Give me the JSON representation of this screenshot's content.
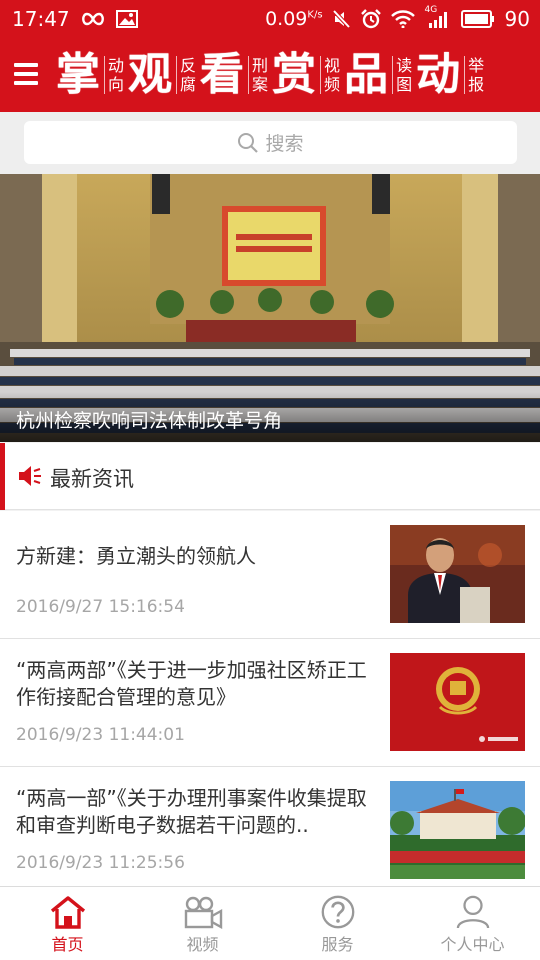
{
  "status_bar": {
    "time": "17:47",
    "network_speed": "0.09",
    "network_speed_unit": "K/s",
    "network_type": "4G",
    "battery": "90"
  },
  "header": {
    "nav_items": [
      {
        "big": "掌",
        "small": [
          "动",
          "向"
        ]
      },
      {
        "big": "观",
        "small": [
          "反",
          "腐"
        ]
      },
      {
        "big": "看",
        "small": [
          "刑",
          "案"
        ]
      },
      {
        "big": "赏",
        "small": [
          "视",
          "频"
        ]
      },
      {
        "big": "品",
        "small": [
          "读",
          "图"
        ]
      },
      {
        "big": "动",
        "small": [
          "举",
          "报"
        ]
      }
    ]
  },
  "search": {
    "placeholder": "搜索"
  },
  "banner": {
    "caption": "杭州检察吹响司法体制改革号角"
  },
  "section": {
    "title": "最新资讯"
  },
  "news": [
    {
      "title": "方新建：勇立潮头的领航人",
      "date": "2016/9/27 15:16:54"
    },
    {
      "title": "“两高两部”《关于进一步加强社区矫正工作衔接配合管理的意见》",
      "date": "2016/9/23 11:44:01"
    },
    {
      "title": "“两高一部”《关于办理刑事案件收集提取和审查判断电子数据若干问题的..",
      "date": "2016/9/23 11:25:56"
    }
  ],
  "tabs": [
    {
      "label": "首页",
      "icon": "home-icon",
      "active": true
    },
    {
      "label": "视频",
      "icon": "video-icon",
      "active": false
    },
    {
      "label": "服务",
      "icon": "help-icon",
      "active": false
    },
    {
      "label": "个人中心",
      "icon": "user-icon",
      "active": false
    }
  ],
  "colors": {
    "brand_red": "#d4121b",
    "inactive_tab": "#999999"
  }
}
